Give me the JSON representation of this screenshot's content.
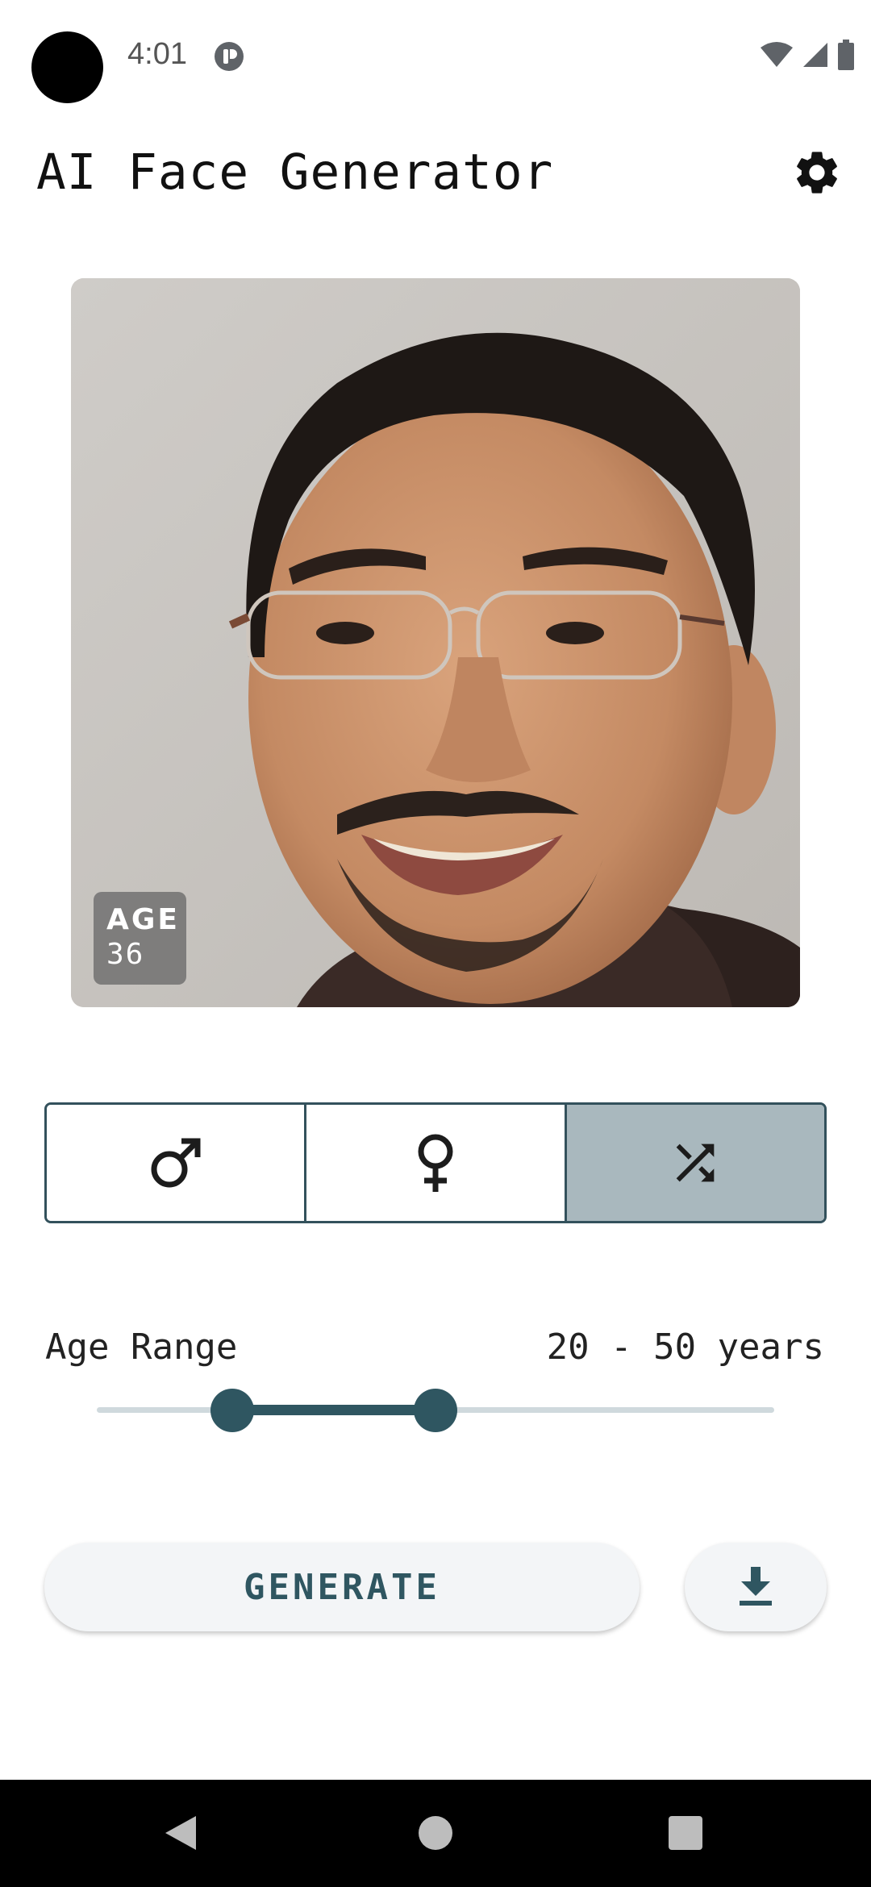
{
  "status_bar": {
    "time": "4:01",
    "icons": [
      "notification-icon",
      "wifi-icon",
      "cell-signal-icon",
      "battery-icon"
    ]
  },
  "app_bar": {
    "title": "AI Face Generator",
    "settings_icon": "gear-icon"
  },
  "face": {
    "age_label": "AGE",
    "age_value": "36"
  },
  "gender_toggle": {
    "options": [
      {
        "icon": "male-symbol-icon",
        "selected": false
      },
      {
        "icon": "female-symbol-icon",
        "selected": false
      },
      {
        "icon": "shuffle-icon",
        "selected": true
      }
    ]
  },
  "age_range": {
    "label": "Age Range",
    "value_text": "20 - 50 years",
    "min_value": 20,
    "max_value": 50,
    "slider_fractions": [
      0.2,
      0.5
    ]
  },
  "actions": {
    "generate_label": "GENERATE",
    "download_icon": "download-icon"
  },
  "colors": {
    "accent": "#2f5661",
    "selected_toggle": "#a9b8be",
    "track_inactive": "#cfd9dd"
  }
}
